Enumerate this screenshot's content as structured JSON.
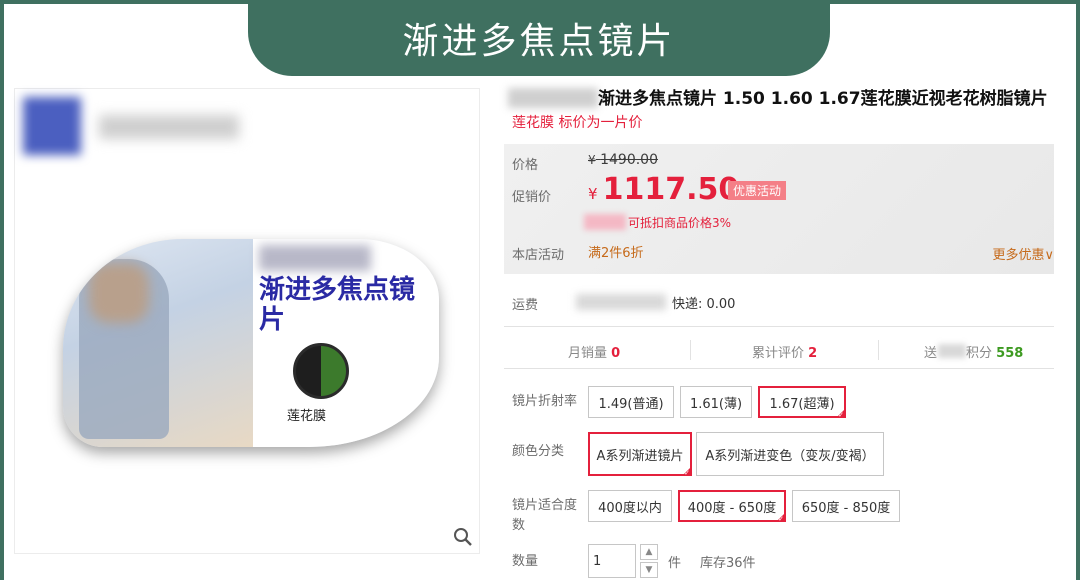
{
  "banner": {
    "title": "渐进多焦点镜片"
  },
  "gallery": {
    "lens_heading": "渐进多焦点镜片",
    "lotus_label": "莲花膜",
    "zoom_icon": "magnifier-icon"
  },
  "product": {
    "title": "渐进多焦点镜片 1.50 1.60 1.67莲花膜近视老花树脂镜片",
    "subtitle": "莲花膜 标价为一片价"
  },
  "price": {
    "orig_label": "价格",
    "orig_yen": "¥",
    "orig_value": "1490.00",
    "promo_label": "促销价",
    "promo_yen": "¥",
    "promo_value": "1117.50",
    "promo_badge": "优惠活动",
    "deduct_text": "可抵扣商品价格3%",
    "store_label": "本店活动",
    "store_value": "满2件6折",
    "more_offers": "更多优惠∨"
  },
  "shipping": {
    "label": "运费",
    "value": "快递: 0.00"
  },
  "stats": {
    "sales_label": "月销量",
    "sales_value": "0",
    "reviews_label": "累计评价",
    "reviews_value": "2",
    "points_prefix": "送",
    "points_label": "积分",
    "points_value": "558"
  },
  "options": {
    "index_label": "镜片折射率",
    "index_values": [
      "1.49(普通)",
      "1.61(薄)",
      "1.67(超薄)"
    ],
    "color_label": "颜色分类",
    "color_values": [
      "A系列渐进镜片",
      "A系列渐进变色（变灰/变褐）"
    ],
    "degree_label": "镜片适合度数",
    "degree_values": [
      "400度以内",
      "400度 - 650度",
      "650度 - 850度"
    ]
  },
  "quantity": {
    "label": "数量",
    "value": "1",
    "unit": "件",
    "stock": "库存36件"
  },
  "colors": {
    "brand_green": "#3f7060",
    "accent_red": "#e4203c",
    "orange": "#c66a1a"
  }
}
